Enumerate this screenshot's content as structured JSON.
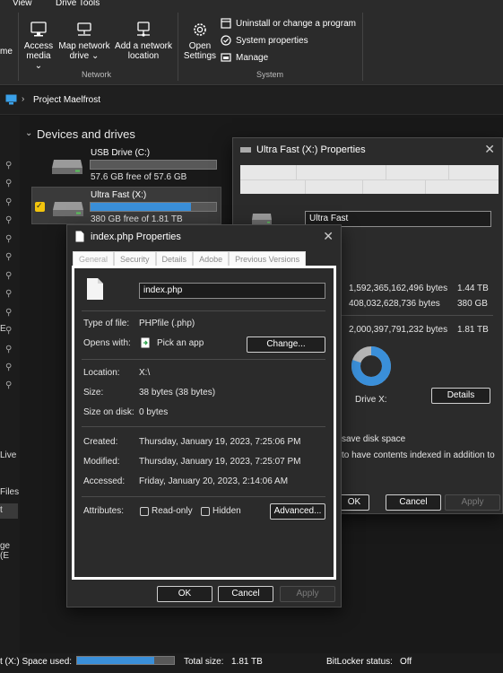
{
  "ribbon": {
    "tabs": [
      "View",
      "Drive Tools"
    ],
    "network": {
      "label": "Network",
      "buttons": [
        {
          "line1": "Access",
          "line2": "media"
        },
        {
          "line1": "Map network",
          "line2": "drive"
        },
        {
          "line1": "Add a network",
          "line2": "location"
        }
      ]
    },
    "partial_label": "me",
    "system": {
      "label": "System",
      "open_settings_line1": "Open",
      "open_settings_line2": "Settings",
      "items": [
        "Uninstall or change a program",
        "System properties",
        "Manage"
      ]
    }
  },
  "address": {
    "path": "Project Maelfrost"
  },
  "section_title": "Devices and drives",
  "drives": [
    {
      "name": "USB Drive (C:)",
      "free": "57.6 GB free of 57.6 GB",
      "used_fraction": 0.0
    },
    {
      "name": "Ultra Fast (X:)",
      "free": "380 GB free of 1.81 TB",
      "used_fraction": 0.8
    }
  ],
  "sidebar_partial": [
    "E",
    "Live",
    "Files",
    "t",
    "",
    "ge (E"
  ],
  "drive_props": {
    "title": "Ultra Fast (X:) Properties",
    "name_value": "Ultra Fast",
    "used_bytes": "1,592,365,162,496 bytes",
    "used_size": "1.44 TB",
    "free_bytes": "408,032,628,736 bytes",
    "free_size": "380 GB",
    "capacity_bytes": "2,000,397,791,232 bytes",
    "capacity_size": "1.81 TB",
    "drive_label": "Drive X:",
    "details_label": "Details",
    "compress_partial": "save disk space",
    "index_partial": "to have contents indexed in addition to",
    "ok": "OK",
    "cancel": "Cancel",
    "apply": "Apply",
    "used_fraction": 0.8,
    "colors": {
      "used": "#3a8fd9",
      "free": "#b5b5b5"
    }
  },
  "file_props": {
    "title": "index.php Properties",
    "tabs": [
      "General",
      "Security",
      "Details",
      "Adobe",
      "Previous Versions"
    ],
    "file_name": "index.php",
    "type_label": "Type of file:",
    "type_value": "PHPfile (.php)",
    "opens_label": "Opens with:",
    "opens_value": "Pick an app",
    "change_btn": "Change...",
    "location_label": "Location:",
    "location_value": "X:\\",
    "size_label": "Size:",
    "size_value": "38 bytes (38 bytes)",
    "disk_label": "Size on disk:",
    "disk_value": "0 bytes",
    "created_label": "Created:",
    "created_value": "Thursday, January 19, 2023, 7:25:06 PM",
    "modified_label": "Modified:",
    "modified_value": "Thursday, January 19, 2023, 7:25:07 PM",
    "accessed_label": "Accessed:",
    "accessed_value": "Friday, January 20, 2023, 2:14:06 AM",
    "attributes_label": "Attributes:",
    "readonly_label": "Read-only",
    "hidden_label": "Hidden",
    "advanced_btn": "Advanced...",
    "ok": "OK",
    "cancel": "Cancel",
    "apply": "Apply"
  },
  "status": {
    "space_used_label": "t (X:) Space used:",
    "used_fraction": 0.8,
    "total_label": "Total size:",
    "total_value": "1.81 TB",
    "bitlocker_label": "BitLocker status:",
    "bitlocker_value": "Off"
  }
}
